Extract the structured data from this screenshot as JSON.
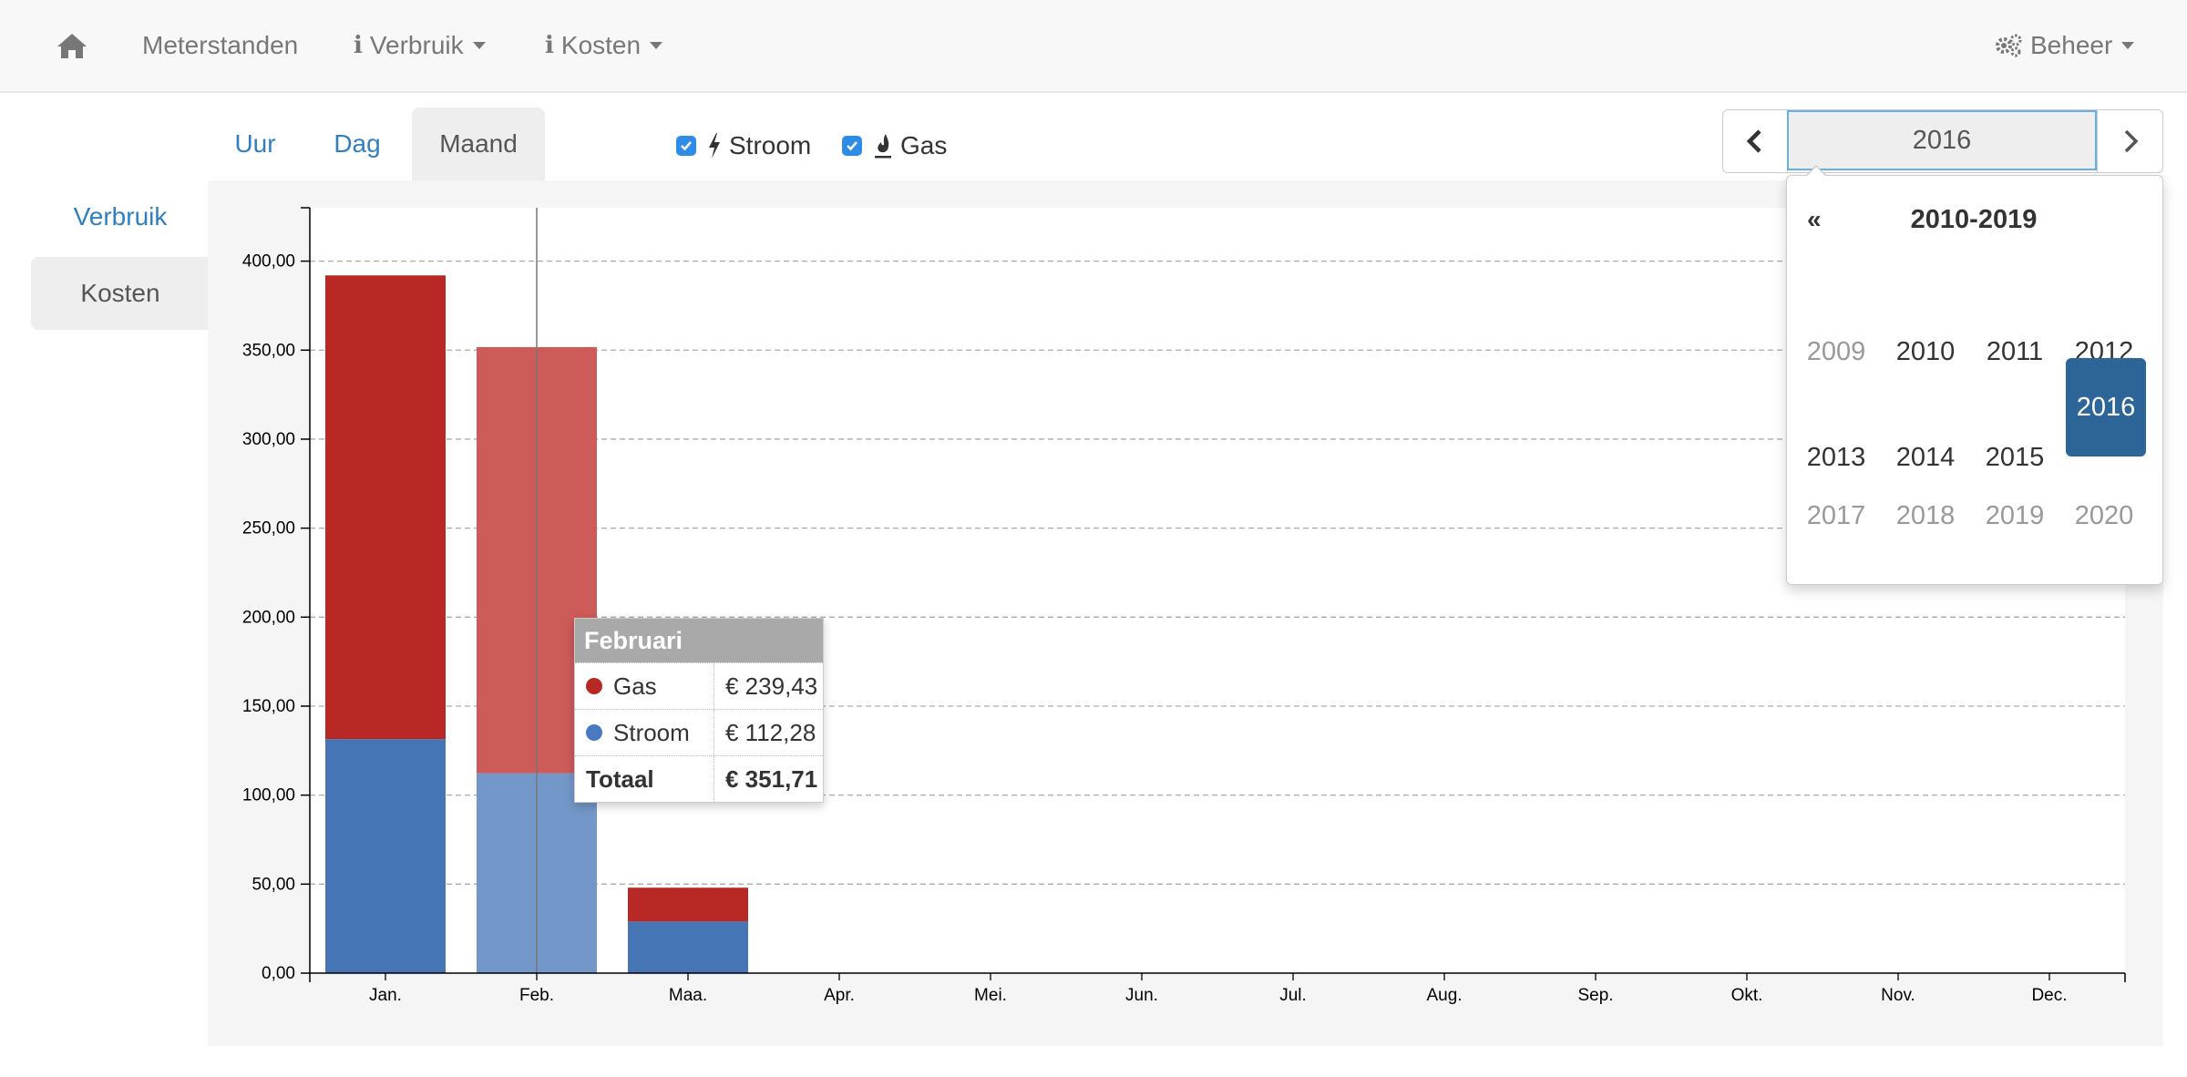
{
  "nav": {
    "home_icon": "home-icon",
    "meterstanden": "Meterstanden",
    "verbruik": "Verbruik",
    "kosten": "Kosten",
    "beheer": "Beheer"
  },
  "sidebar": {
    "items": [
      {
        "label": "Verbruik",
        "active": false
      },
      {
        "label": "Kosten",
        "active": true
      }
    ]
  },
  "tabs": [
    {
      "label": "Uur",
      "active": false
    },
    {
      "label": "Dag",
      "active": false
    },
    {
      "label": "Maand",
      "active": true
    }
  ],
  "legend": {
    "stroom": {
      "label": "Stroom",
      "checked": true,
      "icon": "bolt-icon"
    },
    "gas": {
      "label": "Gas",
      "checked": true,
      "icon": "fire-icon"
    }
  },
  "year_picker": {
    "value": "2016",
    "decade": "2010-2019",
    "prev_glyph": "«",
    "years": [
      {
        "y": "2009",
        "muted": true
      },
      {
        "y": "2010",
        "muted": false
      },
      {
        "y": "2011",
        "muted": false
      },
      {
        "y": "2012",
        "muted": false
      },
      {
        "y": "2013",
        "muted": false
      },
      {
        "y": "2014",
        "muted": false
      },
      {
        "y": "2015",
        "muted": false
      },
      {
        "y": "2016",
        "muted": false,
        "selected": true
      },
      {
        "y": "2017",
        "muted": true
      },
      {
        "y": "2018",
        "muted": true
      },
      {
        "y": "2019",
        "muted": true
      },
      {
        "y": "2020",
        "muted": true
      }
    ]
  },
  "tooltip": {
    "title": "Februari",
    "rows": [
      {
        "name": "Gas",
        "value": "€ 239,43",
        "color": "#b82925"
      },
      {
        "name": "Stroom",
        "value": "€ 112,28",
        "color": "#4575b4"
      }
    ],
    "total_label": "Totaal",
    "total_value": "€ 351,71"
  },
  "colors": {
    "stroom": "#4575b4",
    "gas": "#b82925",
    "stroom_highlight": "#7397c8",
    "gas_highlight": "#cc5b59",
    "accent": "#2d6599",
    "link": "#2f7fc1"
  },
  "chart_data": {
    "type": "bar",
    "stacked": true,
    "categories": [
      "Jan.",
      "Feb.",
      "Maa.",
      "Apr.",
      "Mei.",
      "Jun.",
      "Jul.",
      "Aug.",
      "Sep.",
      "Okt.",
      "Nov.",
      "Dec."
    ],
    "series": [
      {
        "name": "Stroom",
        "values": [
          131.5,
          112.28,
          29.0,
          0,
          0,
          0,
          0,
          0,
          0,
          0,
          0,
          0
        ]
      },
      {
        "name": "Gas",
        "values": [
          260.5,
          239.43,
          19.0,
          0,
          0,
          0,
          0,
          0,
          0,
          0,
          0,
          0
        ]
      }
    ],
    "ylim": [
      0,
      430
    ],
    "yticks": [
      "0,00",
      "50,00",
      "100,00",
      "150,00",
      "200,00",
      "250,00",
      "300,00",
      "350,00",
      "400,00"
    ],
    "highlighted_category": "Feb.",
    "grid": true
  }
}
